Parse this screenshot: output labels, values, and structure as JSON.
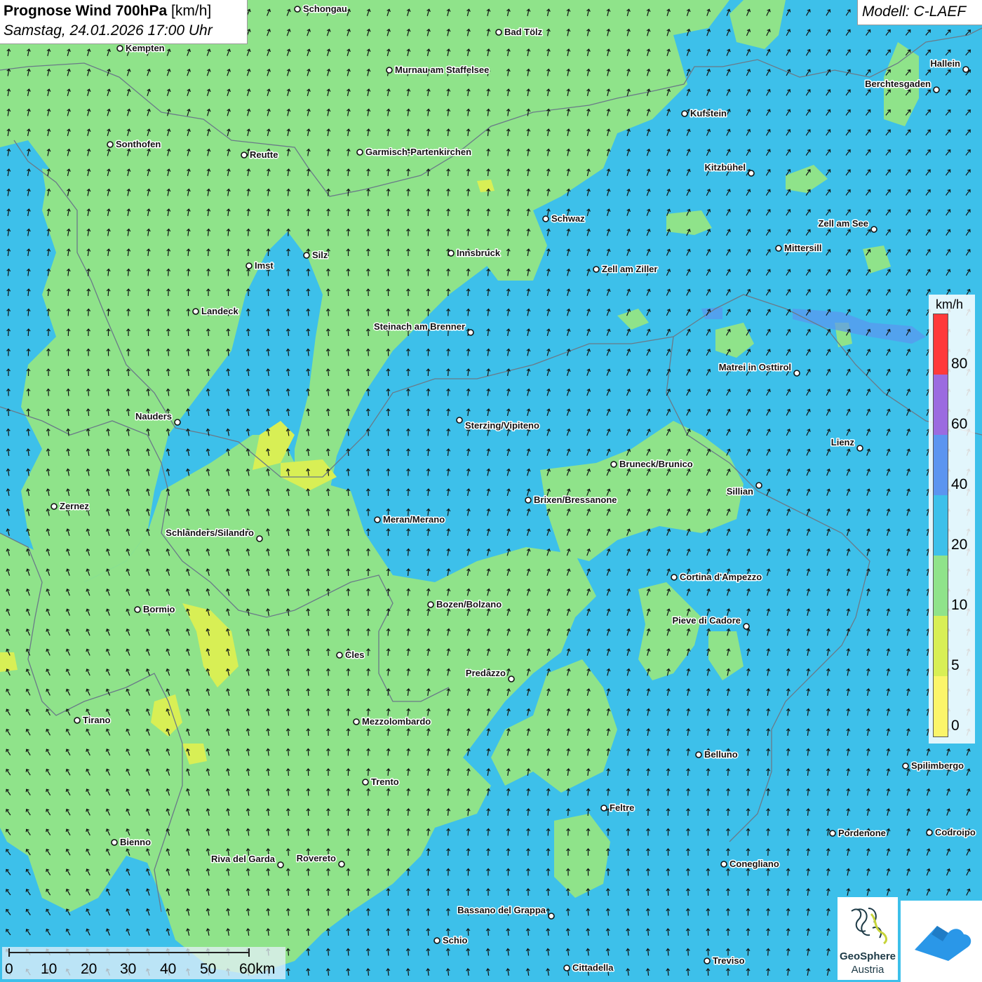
{
  "header": {
    "title_bold": "Prognose Wind 700hPa",
    "title_unit": "[km/h]",
    "datetime": "Samstag, 24.01.2026 17:00 Uhr",
    "model": "Modell: C-LAEF"
  },
  "legend": {
    "unit": "km/h",
    "labels": [
      "80",
      "60",
      "40",
      "20",
      "10",
      "5",
      "0"
    ],
    "colors": [
      "#ff3a3a",
      "#9b6be0",
      "#5b95f0",
      "#3dc0ea",
      "#8fe38a",
      "#d8ef55",
      "#fbf56a"
    ]
  },
  "scale_bar": {
    "labels": [
      "0",
      "10",
      "20",
      "30",
      "40",
      "50",
      "60km"
    ]
  },
  "colors": {
    "speed_10_20": "#8fe38a",
    "speed_20_40": "#3dc0ea",
    "speed_5_10": "#d8ef55",
    "speed_40_60": "#5b95f0"
  },
  "cities": [
    {
      "name": "Schongau"
    },
    {
      "name": "Bad Tölz"
    },
    {
      "name": "Kempten"
    },
    {
      "name": "Murnau am Staffelsee"
    },
    {
      "name": "Hallein"
    },
    {
      "name": "Berchtesgaden"
    },
    {
      "name": "Kufstein"
    },
    {
      "name": "Sonthofen"
    },
    {
      "name": "Reutte"
    },
    {
      "name": "Garmisch-Partenkirchen"
    },
    {
      "name": "Kitzbühel"
    },
    {
      "name": "Schwaz"
    },
    {
      "name": "Zell am See"
    },
    {
      "name": "Mittersill"
    },
    {
      "name": "Imst"
    },
    {
      "name": "Silz"
    },
    {
      "name": "Innsbruck"
    },
    {
      "name": "Zell am Ziller"
    },
    {
      "name": "Landeck"
    },
    {
      "name": "Steinach am Brenner"
    },
    {
      "name": "Matrei in Osttirol"
    },
    {
      "name": "Nauders"
    },
    {
      "name": "Sterzing/Vipiteno"
    },
    {
      "name": "Lienz"
    },
    {
      "name": "Bruneck/Brunico"
    },
    {
      "name": "Sillian"
    },
    {
      "name": "Brixen/Bressanone"
    },
    {
      "name": "Zernez"
    },
    {
      "name": "Meran/Merano"
    },
    {
      "name": "Schlanders/Silandro"
    },
    {
      "name": "Cortina d'Ampezzo"
    },
    {
      "name": "Bozen/Bolzano"
    },
    {
      "name": "Bormio"
    },
    {
      "name": "Pieve di Cadore"
    },
    {
      "name": "Cles"
    },
    {
      "name": "Predazzo"
    },
    {
      "name": "Tirano"
    },
    {
      "name": "Mezzolombardo"
    },
    {
      "name": "Belluno"
    },
    {
      "name": "Spilimbergo"
    },
    {
      "name": "Trento"
    },
    {
      "name": "Feltre"
    },
    {
      "name": "Pordenone"
    },
    {
      "name": "Codroipo"
    },
    {
      "name": "Bienno"
    },
    {
      "name": "Riva del Garda"
    },
    {
      "name": "Rovereto"
    },
    {
      "name": "Conegliano"
    },
    {
      "name": "Bassano del Grappa"
    },
    {
      "name": "Schio"
    },
    {
      "name": "Treviso"
    },
    {
      "name": "Cittadella"
    }
  ],
  "logos": {
    "geosphere_line1": "GeoSphere",
    "geosphere_line2": "Austria"
  }
}
